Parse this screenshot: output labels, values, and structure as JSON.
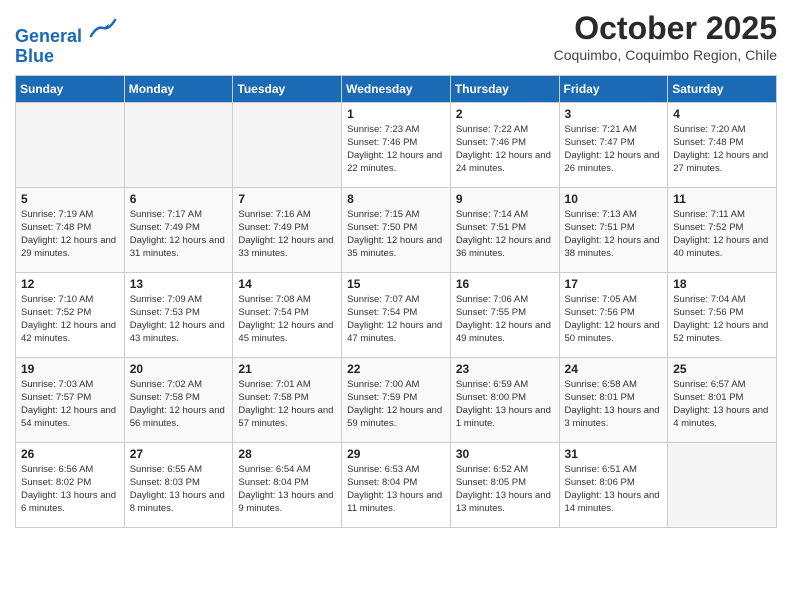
{
  "header": {
    "logo_line1": "General",
    "logo_line2": "Blue",
    "month_title": "October 2025",
    "subtitle": "Coquimbo, Coquimbo Region, Chile"
  },
  "days_of_week": [
    "Sunday",
    "Monday",
    "Tuesday",
    "Wednesday",
    "Thursday",
    "Friday",
    "Saturday"
  ],
  "weeks": [
    [
      {
        "day": "",
        "empty": true
      },
      {
        "day": "",
        "empty": true
      },
      {
        "day": "",
        "empty": true
      },
      {
        "day": "1",
        "sunrise": "7:23 AM",
        "sunset": "7:46 PM",
        "daylight": "12 hours and 22 minutes."
      },
      {
        "day": "2",
        "sunrise": "7:22 AM",
        "sunset": "7:46 PM",
        "daylight": "12 hours and 24 minutes."
      },
      {
        "day": "3",
        "sunrise": "7:21 AM",
        "sunset": "7:47 PM",
        "daylight": "12 hours and 26 minutes."
      },
      {
        "day": "4",
        "sunrise": "7:20 AM",
        "sunset": "7:48 PM",
        "daylight": "12 hours and 27 minutes."
      }
    ],
    [
      {
        "day": "5",
        "sunrise": "7:19 AM",
        "sunset": "7:48 PM",
        "daylight": "12 hours and 29 minutes."
      },
      {
        "day": "6",
        "sunrise": "7:17 AM",
        "sunset": "7:49 PM",
        "daylight": "12 hours and 31 minutes."
      },
      {
        "day": "7",
        "sunrise": "7:16 AM",
        "sunset": "7:49 PM",
        "daylight": "12 hours and 33 minutes."
      },
      {
        "day": "8",
        "sunrise": "7:15 AM",
        "sunset": "7:50 PM",
        "daylight": "12 hours and 35 minutes."
      },
      {
        "day": "9",
        "sunrise": "7:14 AM",
        "sunset": "7:51 PM",
        "daylight": "12 hours and 36 minutes."
      },
      {
        "day": "10",
        "sunrise": "7:13 AM",
        "sunset": "7:51 PM",
        "daylight": "12 hours and 38 minutes."
      },
      {
        "day": "11",
        "sunrise": "7:11 AM",
        "sunset": "7:52 PM",
        "daylight": "12 hours and 40 minutes."
      }
    ],
    [
      {
        "day": "12",
        "sunrise": "7:10 AM",
        "sunset": "7:52 PM",
        "daylight": "12 hours and 42 minutes."
      },
      {
        "day": "13",
        "sunrise": "7:09 AM",
        "sunset": "7:53 PM",
        "daylight": "12 hours and 43 minutes."
      },
      {
        "day": "14",
        "sunrise": "7:08 AM",
        "sunset": "7:54 PM",
        "daylight": "12 hours and 45 minutes."
      },
      {
        "day": "15",
        "sunrise": "7:07 AM",
        "sunset": "7:54 PM",
        "daylight": "12 hours and 47 minutes."
      },
      {
        "day": "16",
        "sunrise": "7:06 AM",
        "sunset": "7:55 PM",
        "daylight": "12 hours and 49 minutes."
      },
      {
        "day": "17",
        "sunrise": "7:05 AM",
        "sunset": "7:56 PM",
        "daylight": "12 hours and 50 minutes."
      },
      {
        "day": "18",
        "sunrise": "7:04 AM",
        "sunset": "7:56 PM",
        "daylight": "12 hours and 52 minutes."
      }
    ],
    [
      {
        "day": "19",
        "sunrise": "7:03 AM",
        "sunset": "7:57 PM",
        "daylight": "12 hours and 54 minutes."
      },
      {
        "day": "20",
        "sunrise": "7:02 AM",
        "sunset": "7:58 PM",
        "daylight": "12 hours and 56 minutes."
      },
      {
        "day": "21",
        "sunrise": "7:01 AM",
        "sunset": "7:58 PM",
        "daylight": "12 hours and 57 minutes."
      },
      {
        "day": "22",
        "sunrise": "7:00 AM",
        "sunset": "7:59 PM",
        "daylight": "12 hours and 59 minutes."
      },
      {
        "day": "23",
        "sunrise": "6:59 AM",
        "sunset": "8:00 PM",
        "daylight": "13 hours and 1 minute."
      },
      {
        "day": "24",
        "sunrise": "6:58 AM",
        "sunset": "8:01 PM",
        "daylight": "13 hours and 3 minutes."
      },
      {
        "day": "25",
        "sunrise": "6:57 AM",
        "sunset": "8:01 PM",
        "daylight": "13 hours and 4 minutes."
      }
    ],
    [
      {
        "day": "26",
        "sunrise": "6:56 AM",
        "sunset": "8:02 PM",
        "daylight": "13 hours and 6 minutes."
      },
      {
        "day": "27",
        "sunrise": "6:55 AM",
        "sunset": "8:03 PM",
        "daylight": "13 hours and 8 minutes."
      },
      {
        "day": "28",
        "sunrise": "6:54 AM",
        "sunset": "8:04 PM",
        "daylight": "13 hours and 9 minutes."
      },
      {
        "day": "29",
        "sunrise": "6:53 AM",
        "sunset": "8:04 PM",
        "daylight": "13 hours and 11 minutes."
      },
      {
        "day": "30",
        "sunrise": "6:52 AM",
        "sunset": "8:05 PM",
        "daylight": "13 hours and 13 minutes."
      },
      {
        "day": "31",
        "sunrise": "6:51 AM",
        "sunset": "8:06 PM",
        "daylight": "13 hours and 14 minutes."
      },
      {
        "day": "",
        "empty": true
      }
    ]
  ]
}
